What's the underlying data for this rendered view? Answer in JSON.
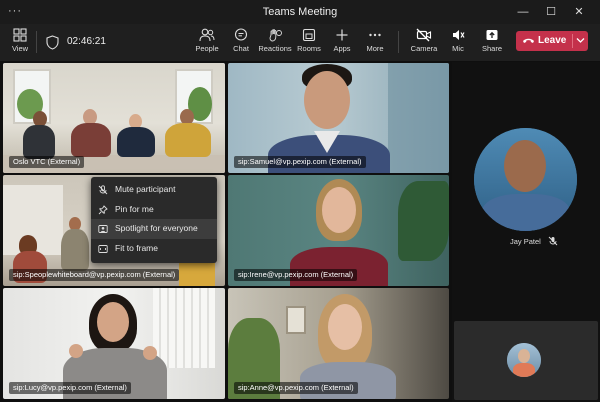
{
  "window": {
    "title": "Teams Meeting",
    "menu_glyph": "···",
    "minimize": "—",
    "maximize": "☐",
    "close": "✕"
  },
  "toolbar": {
    "view_label": "View",
    "timer": "02:46:21",
    "people_label": "People",
    "chat_label": "Chat",
    "reactions_label": "Reactions",
    "rooms_label": "Rooms",
    "apps_label": "Apps",
    "more_label": "More",
    "camera_label": "Camera",
    "mic_label": "Mic",
    "share_label": "Share",
    "leave_label": "Leave"
  },
  "tiles": [
    {
      "name": "Oslo VTC (External)"
    },
    {
      "name": "sip:Samuel@vp.pexip.com (External)"
    },
    {
      "name": "sip:Speoplewhiteboard@vp.pexip.com (External)"
    },
    {
      "name": "sip:Irene@vp.pexip.com (External)"
    },
    {
      "name": "sip:Lucy@vp.pexip.com (External)"
    },
    {
      "name": "sip:Anne@vp.pexip.com (External)"
    }
  ],
  "context_menu": {
    "items": [
      {
        "label": "Mute participant"
      },
      {
        "label": "Pin for me"
      },
      {
        "label": "Spotlight for everyone"
      },
      {
        "label": "Fit to frame"
      }
    ]
  },
  "side_panel": {
    "featured_name": "Jay Patel"
  },
  "colors": {
    "leave": "#c4314b",
    "selected_outline": "#8b8ccf",
    "toolbar_bg": "#1f1f1f"
  }
}
